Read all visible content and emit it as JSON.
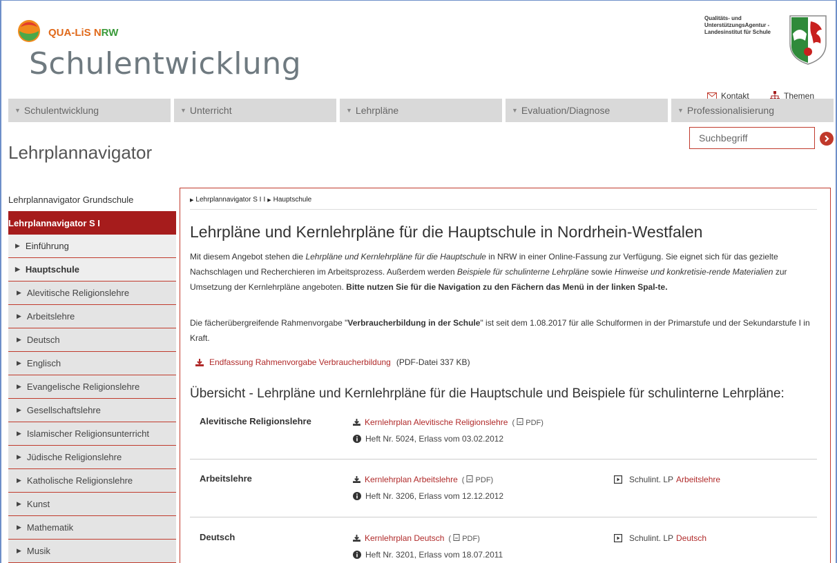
{
  "header": {
    "brand_part1": "QUA-LiS N",
    "brand_part2": "RW",
    "site_title": "Schulentwicklung",
    "agency_line1": "Qualitäts- und",
    "agency_line2": "UnterstützungsAgentur -",
    "agency_line3": "Landesinstitut für Schule",
    "links": {
      "contact": "Kontakt",
      "topics": "Themen"
    }
  },
  "nav": [
    {
      "label": "Schulentwicklung"
    },
    {
      "label": "Unterricht"
    },
    {
      "label": "Lehrpläne"
    },
    {
      "label": "Evaluation/Diagnose"
    },
    {
      "label": "Professionalisierung"
    }
  ],
  "page": {
    "title": "Lehrplannavigator"
  },
  "search": {
    "placeholder": "Suchbegriff"
  },
  "sidebar": {
    "top": "Lehrplannavigator Grundschule",
    "active": "Lehrplannavigator S I",
    "level1": [
      {
        "label": "Einführung"
      },
      {
        "label": "Hauptschule"
      }
    ],
    "level2": [
      {
        "label": "Alevitische Religionslehre"
      },
      {
        "label": "Arbeitslehre"
      },
      {
        "label": "Deutsch"
      },
      {
        "label": "Englisch"
      },
      {
        "label": "Evangelische Religionslehre"
      },
      {
        "label": "Gesellschaftslehre"
      },
      {
        "label": "Islamischer Religionsunterricht"
      },
      {
        "label": "Jüdische Religionslehre"
      },
      {
        "label": "Katholische Religionslehre"
      },
      {
        "label": "Kunst"
      },
      {
        "label": "Mathematik"
      },
      {
        "label": "Musik"
      }
    ]
  },
  "content": {
    "breadcrumb": [
      "Lehrplannavigator S I",
      "Hauptschule"
    ],
    "heading": "Lehrpläne und Kernlehrpläne für die Hauptschule in Nordrhein-Westfalen",
    "intro": {
      "p1_a": "Mit diesem Angebot stehen die ",
      "p1_em1": "Lehrpläne und Kernlehrpläne für die Hauptschule",
      "p1_b": " in NRW in einer Online-Fassung zur Verfügung. Sie eignet sich für das gezielte Nachschlagen und Recherchieren im Arbeitsprozess. Außerdem werden ",
      "p1_em2": "Beispiele für schulinterne Lehrpläne",
      "p1_c": " sowie ",
      "p1_em3": "Hinweise und konkretisie-rende Materialien",
      "p1_d": " zur Umsetzung der Kernlehrpläne angeboten. ",
      "p1_strong": "Bitte nutzen Sie für die Navigation zu den Fächern das Menü in der linken Spal-te.",
      "p2_a": "Die fächerübergreifende Rahmenvorgabe \"",
      "p2_strong": "Verbraucherbildung in der Schule",
      "p2_b": "\" ist seit dem 1.08.2017 für alle Schulformen in der Primarstufe und der Sekundarstufe I in Kraft."
    },
    "download": {
      "label": "Endfassung Rahmenvorgabe Verbraucherbildung",
      "meta": "(PDF-Datei 337 KB)"
    },
    "overview_heading": "Übersicht - Lehrpläne und Kernlehrpläne für die Hauptschule und Beispiele für schulinterne Lehrpläne:",
    "subjects": [
      {
        "name": "Alevitische Religionslehre",
        "plan": "Kernlehrplan Alevitische Religionslehre",
        "pdf": "PDF",
        "info": "Heft Nr. 5024, Erlass vom 03.02.2012",
        "school_prefix": "",
        "school_link": ""
      },
      {
        "name": "Arbeitslehre",
        "plan": "Kernlehrplan Arbeitslehre",
        "pdf": "PDF",
        "info": "Heft Nr. 3206, Erlass vom 12.12.2012",
        "school_prefix": "Schulint. LP ",
        "school_link": "Arbeitslehre"
      },
      {
        "name": "Deutsch",
        "plan": "Kernlehrplan Deutsch",
        "pdf": "PDF",
        "info": "Heft Nr. 3201, Erlass vom 18.07.2011",
        "school_prefix": "Schulint. LP ",
        "school_link": "Deutsch"
      }
    ]
  },
  "colors": {
    "accent": "#a61c1c",
    "link": "#b02a2a",
    "nav_bg": "#d9d9d9",
    "sidebar_bg": "#eeeeee"
  }
}
